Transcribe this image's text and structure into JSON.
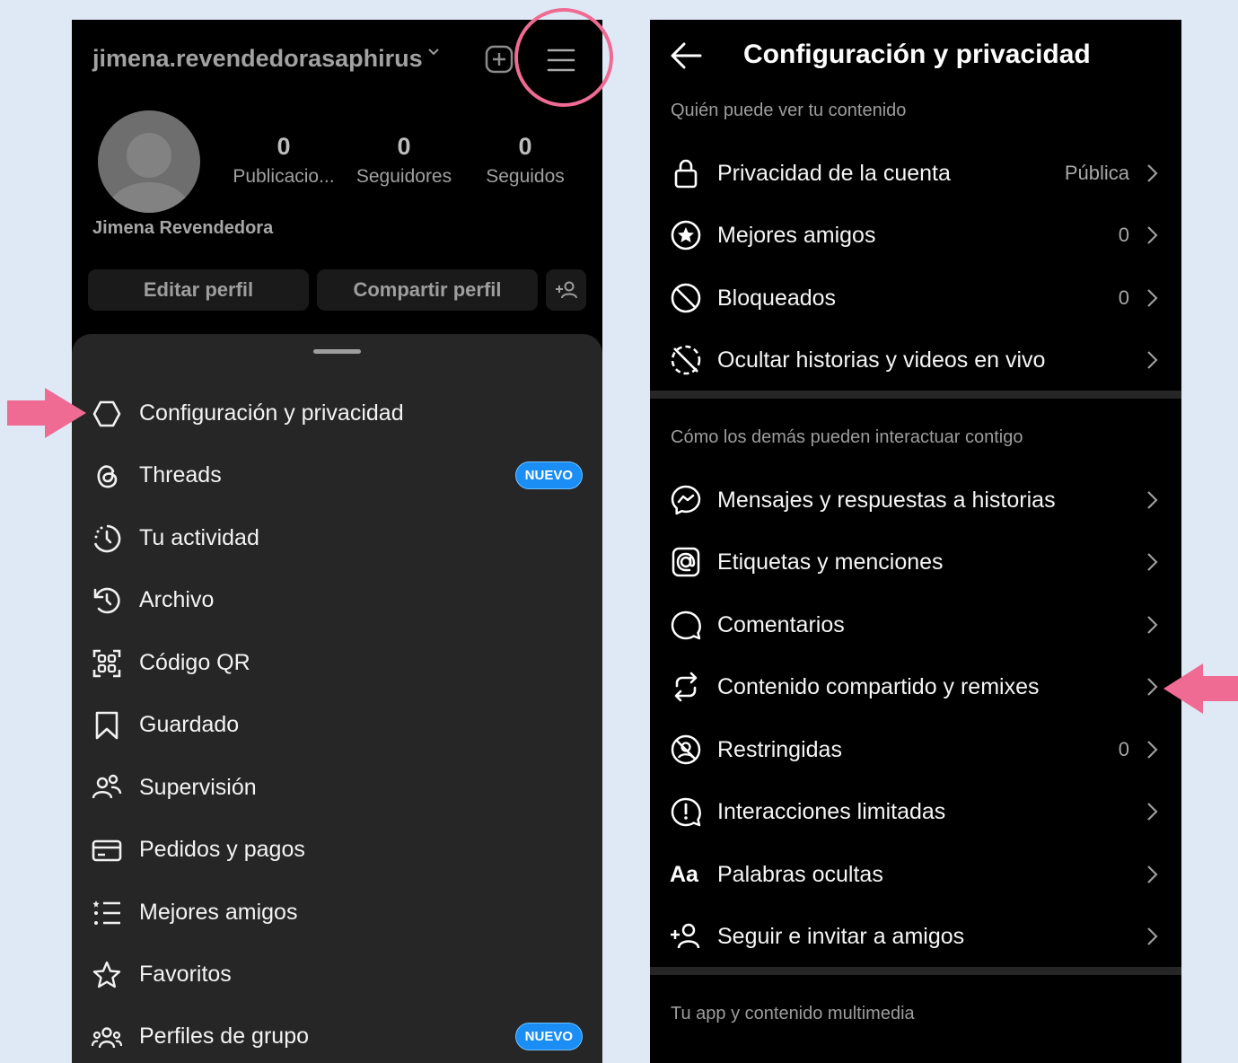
{
  "left_screen": {
    "username": "jimena.revendedorasaphirus",
    "stats": [
      {
        "value": "0",
        "label": "Publicacio..."
      },
      {
        "value": "0",
        "label": "Seguidores"
      },
      {
        "value": "0",
        "label": "Seguidos"
      }
    ],
    "full_name": "Jimena Revendedora",
    "edit_profile": "Editar perfil",
    "share_profile": "Compartir perfil",
    "menu": [
      {
        "label": "Configuración y privacidad",
        "icon": "settings-icon"
      },
      {
        "label": "Threads",
        "icon": "threads-icon",
        "badge": "NUEVO"
      },
      {
        "label": "Tu actividad",
        "icon": "activity-icon"
      },
      {
        "label": "Archivo",
        "icon": "archive-icon"
      },
      {
        "label": "Código QR",
        "icon": "qr-icon"
      },
      {
        "label": "Guardado",
        "icon": "bookmark-icon"
      },
      {
        "label": "Supervisión",
        "icon": "supervision-icon"
      },
      {
        "label": "Pedidos y pagos",
        "icon": "card-icon"
      },
      {
        "label": "Mejores amigos",
        "icon": "close-friends-list-icon"
      },
      {
        "label": "Favoritos",
        "icon": "star-icon"
      },
      {
        "label": "Perfiles de grupo",
        "icon": "group-icon",
        "badge": "NUEVO"
      }
    ]
  },
  "right_screen": {
    "title": "Configuración y privacidad",
    "sections": [
      {
        "title": "Quién puede ver tu contenido",
        "items": [
          {
            "label": "Privacidad de la cuenta",
            "value": "Pública",
            "icon": "lock-icon"
          },
          {
            "label": "Mejores amigos",
            "value": "0",
            "icon": "star-circle-icon"
          },
          {
            "label": "Bloqueados",
            "value": "0",
            "icon": "blocked-icon"
          },
          {
            "label": "Ocultar historias y videos en vivo",
            "value": "",
            "icon": "hide-story-icon"
          }
        ]
      },
      {
        "title": "Cómo los demás pueden interactuar contigo",
        "items": [
          {
            "label": "Mensajes y respuestas a historias",
            "value": "",
            "icon": "messenger-icon"
          },
          {
            "label": "Etiquetas y menciones",
            "value": "",
            "icon": "at-icon"
          },
          {
            "label": "Comentarios",
            "value": "",
            "icon": "comment-icon"
          },
          {
            "label": "Contenido compartido y remixes",
            "value": "",
            "icon": "remix-icon"
          },
          {
            "label": "Restringidas",
            "value": "0",
            "icon": "restricted-icon"
          },
          {
            "label": "Interacciones limitadas",
            "value": "",
            "icon": "limited-icon"
          },
          {
            "label": "Palabras ocultas",
            "value": "",
            "icon": "hidden-words-icon",
            "icon_text": "Aa"
          },
          {
            "label": "Seguir e invitar a amigos",
            "value": "",
            "icon": "add-person-icon"
          }
        ]
      },
      {
        "title": "Tu app y contenido multimedia",
        "items": []
      }
    ]
  },
  "colors": {
    "background": "#dfe9f5",
    "annotation": "#ef6b94",
    "badge": "#1a8ef5"
  }
}
